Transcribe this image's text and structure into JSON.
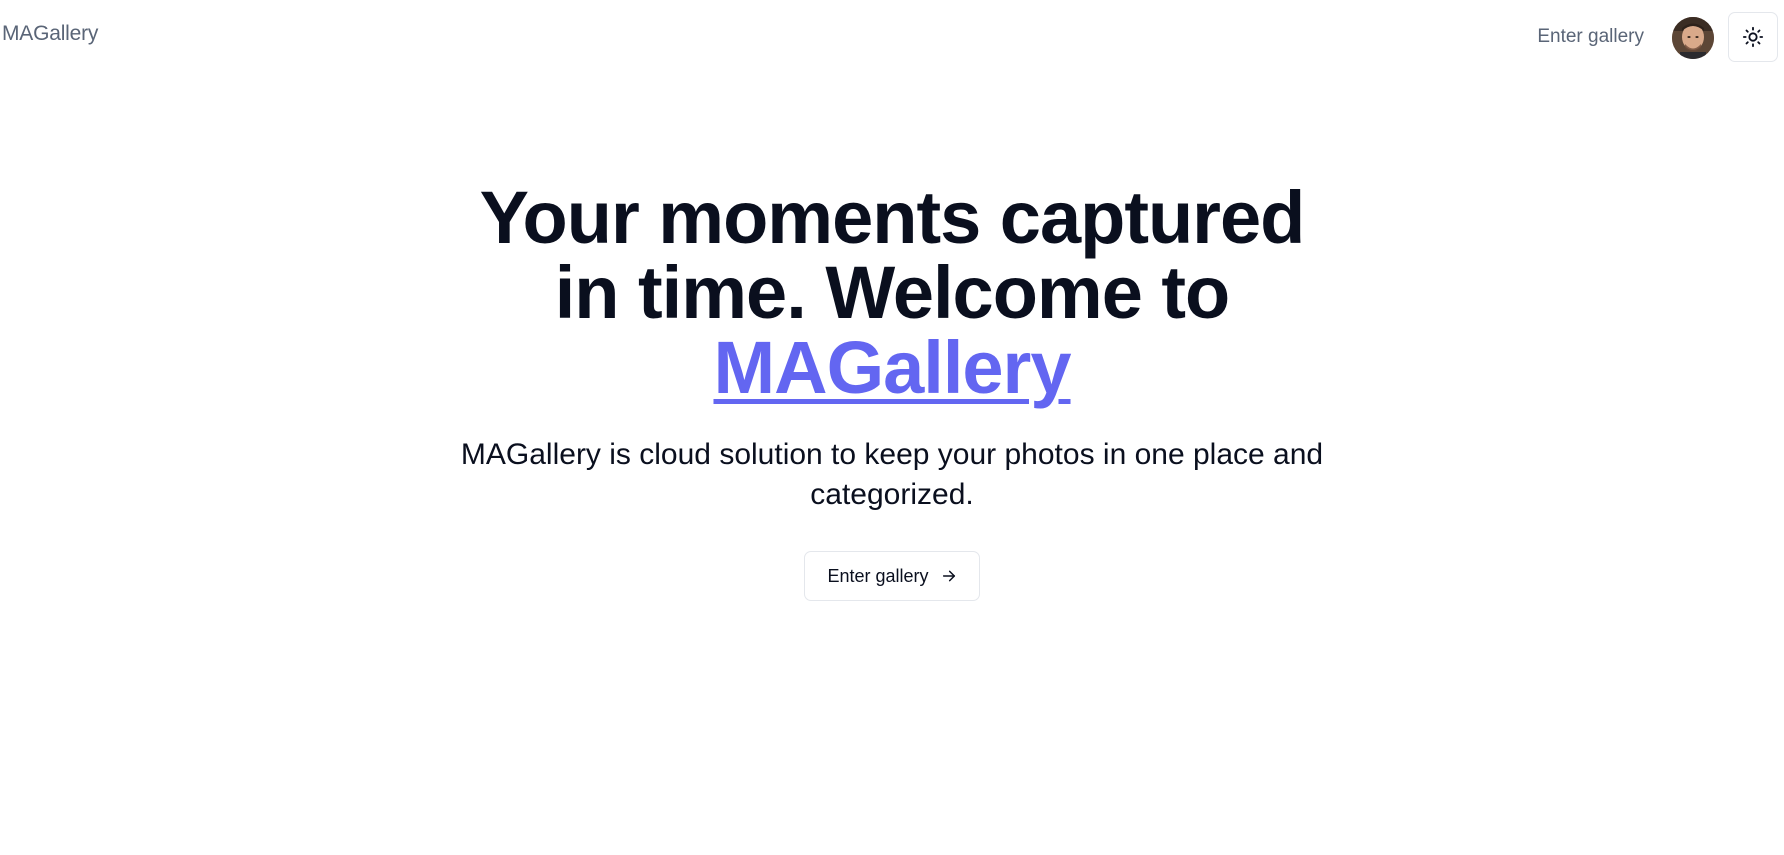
{
  "header": {
    "brand": "MAGallery",
    "nav_link": "Enter gallery",
    "avatar_alt": "user-avatar",
    "theme_toggle_icon": "sun-icon"
  },
  "hero": {
    "headline_part1": "Your moments captured in time. Welcome to",
    "headline_accent": "MAGallery",
    "subtitle": "MAGallery is cloud solution to keep your photos in one place and categorized.",
    "cta_label": "Enter gallery",
    "cta_icon": "arrow-right-icon"
  },
  "colors": {
    "accent": "#6366f1",
    "text": "#0a0f1e",
    "muted": "#5a6577",
    "border": "#e4e7ec"
  }
}
